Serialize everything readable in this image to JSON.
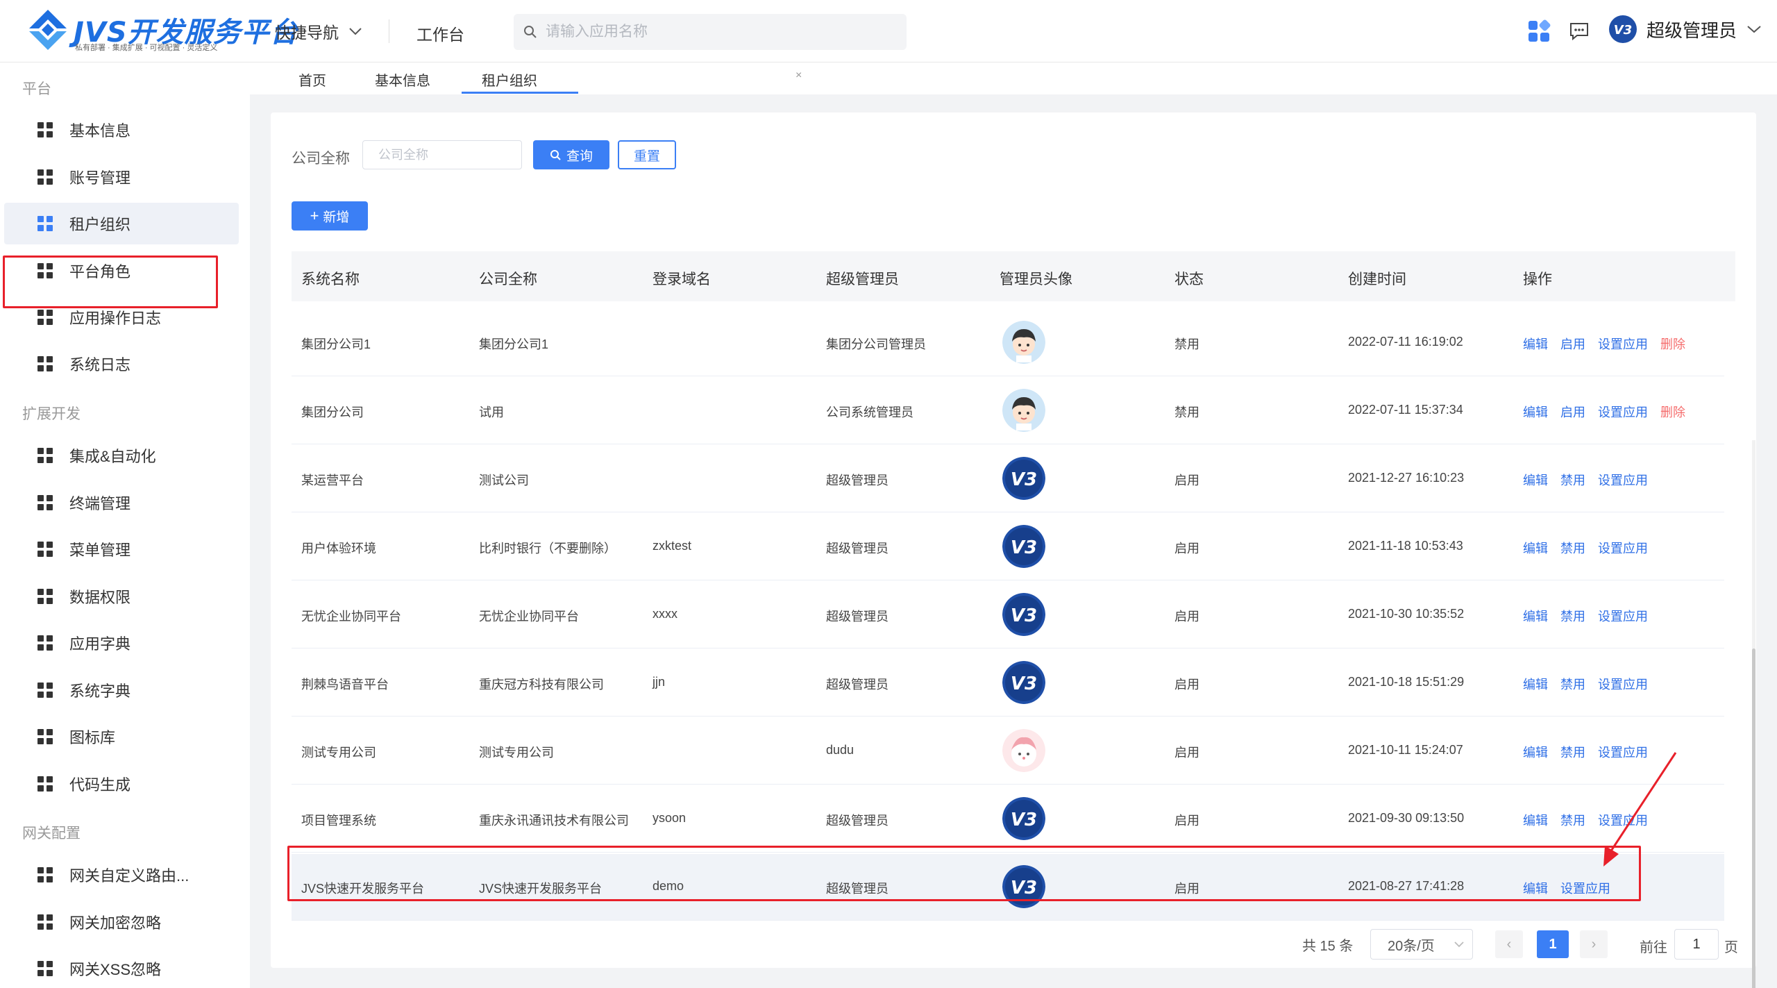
{
  "colors": {
    "accent": "#3b7ff5",
    "danger": "#f56c6c",
    "highlight": "#e8202a",
    "brand": "#1e6fe0"
  },
  "app": {
    "title": "JVS开发服务平台",
    "subtitle": "私有部署 · 集成扩展 · 可视配置 · 灵活定义"
  },
  "header": {
    "quick_nav": "快捷导航",
    "workbench": "工作台",
    "search_placeholder": "请输入应用名称",
    "user_name": "超级管理员"
  },
  "sidebar": {
    "groups": [
      "平台",
      "扩展开发",
      "网关配置"
    ],
    "items": [
      {
        "label": "基本信息"
      },
      {
        "label": "账号管理"
      },
      {
        "label": "租户组织"
      },
      {
        "label": "平台角色"
      },
      {
        "label": "应用操作日志"
      },
      {
        "label": "系统日志"
      },
      {
        "label": "集成&自动化"
      },
      {
        "label": "终端管理"
      },
      {
        "label": "菜单管理"
      },
      {
        "label": "数据权限"
      },
      {
        "label": "应用字典"
      },
      {
        "label": "系统字典"
      },
      {
        "label": "图标库"
      },
      {
        "label": "代码生成"
      },
      {
        "label": "网关自定义路由..."
      },
      {
        "label": "网关加密忽略"
      },
      {
        "label": "网关XSS忽略"
      }
    ]
  },
  "tabs": [
    "首页",
    "基本信息",
    "租户组织"
  ],
  "filter": {
    "label": "公司全称",
    "placeholder": "公司全称",
    "query": "查询",
    "reset": "重置",
    "add": "新增"
  },
  "table": {
    "columns": [
      "系统名称",
      "公司全称",
      "登录域名",
      "超级管理员",
      "管理员头像",
      "状态",
      "创建时间",
      "操作"
    ],
    "rows": [
      {
        "name": "集团分公司1",
        "company": "集团分公司1",
        "domain": "",
        "admin": "集团分公司管理员",
        "avatar": "boy",
        "status": "禁用",
        "created": "2022-07-11 16:19:02",
        "ops": [
          "编辑",
          "启用",
          "设置应用",
          "删除"
        ]
      },
      {
        "name": "集团分公司",
        "company": "试用",
        "domain": "",
        "admin": "公司系统管理员",
        "avatar": "boy",
        "status": "禁用",
        "created": "2022-07-11 15:37:34",
        "ops": [
          "编辑",
          "启用",
          "设置应用",
          "删除"
        ]
      },
      {
        "name": "某运营平台",
        "company": "测试公司",
        "domain": "",
        "admin": "超级管理员",
        "avatar": "v3",
        "status": "启用",
        "created": "2021-12-27 16:10:23",
        "ops": [
          "编辑",
          "禁用",
          "设置应用"
        ]
      },
      {
        "name": "用户体验环境",
        "company": "比利时银行（不要删除）",
        "domain": "zxktest",
        "admin": "超级管理员",
        "avatar": "v3",
        "status": "启用",
        "created": "2021-11-18 10:53:43",
        "ops": [
          "编辑",
          "禁用",
          "设置应用"
        ]
      },
      {
        "name": "无忧企业协同平台",
        "company": "无忧企业协同平台",
        "domain": "xxxx",
        "admin": "超级管理员",
        "avatar": "v3",
        "status": "启用",
        "created": "2021-10-30 10:35:52",
        "ops": [
          "编辑",
          "禁用",
          "设置应用"
        ]
      },
      {
        "name": "荆棘鸟语音平台",
        "company": "重庆冠方科技有限公司",
        "domain": "jjn",
        "admin": "超级管理员",
        "avatar": "v3",
        "status": "启用",
        "created": "2021-10-18 15:51:29",
        "ops": [
          "编辑",
          "禁用",
          "设置应用"
        ]
      },
      {
        "name": "测试专用公司",
        "company": "测试专用公司",
        "domain": "",
        "admin": "dudu",
        "avatar": "pink",
        "status": "启用",
        "created": "2021-10-11 15:24:07",
        "ops": [
          "编辑",
          "禁用",
          "设置应用"
        ]
      },
      {
        "name": "项目管理系统",
        "company": "重庆永讯通讯技术有限公司",
        "domain": "ysoon",
        "admin": "超级管理员",
        "avatar": "v3",
        "status": "启用",
        "created": "2021-09-30 09:13:50",
        "ops": [
          "编辑",
          "禁用",
          "设置应用"
        ]
      },
      {
        "name": "JVS快速开发服务平台",
        "company": "JVS快速开发服务平台",
        "domain": "demo",
        "admin": "超级管理员",
        "avatar": "v3",
        "status": "启用",
        "created": "2021-08-27 17:41:28",
        "ops": [
          "编辑",
          "设置应用"
        ]
      }
    ]
  },
  "pagination": {
    "total": "共 15 条",
    "page_size": "20条/页",
    "current": "1",
    "goto_label": "前往",
    "goto_value": "1",
    "page_label": "页"
  }
}
